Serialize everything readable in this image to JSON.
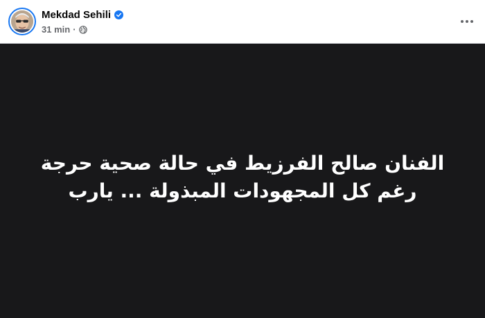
{
  "author": {
    "name": "Mekdad Sehili",
    "verified": true
  },
  "meta": {
    "time": "31 min",
    "separator": "·",
    "audience_icon": "globe-icon"
  },
  "more_icon": "more-horizontal-icon",
  "post": {
    "background_color": "#18181a",
    "lines": [
      "الفنان صالح الفرزيط في حالة صحية حرجة",
      "رغم كل المجهودات المبذولة ... يارب"
    ]
  },
  "colors": {
    "accent": "#1877f2",
    "secondary_text": "#65676b"
  }
}
